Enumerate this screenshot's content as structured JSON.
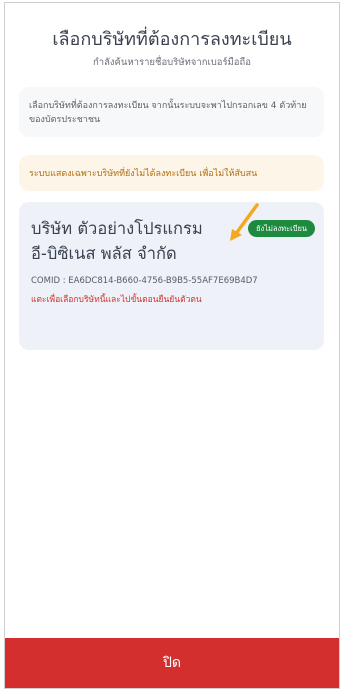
{
  "header": {
    "title": "เลือกบริษัทที่ต้องการลงทะเบียน",
    "subtitle": "กำลังค้นหารายชื่อบริษัทจากเบอร์มือถือ"
  },
  "instruction": {
    "text": "เลือกบริษัทที่ต้องการลงทะเบียน จากนั้นระบบจะพาไปกรอกเลข 4 ตัวท้ายของบัตรประชาชน"
  },
  "warning": {
    "text": "ระบบแสดงเฉพาะบริษัทที่ยังไม่ได้ลงทะเบียน เพื่อไม่ให้สับสน"
  },
  "company": {
    "name_line1": "บริษัท ตัวอย่างโปรแกรม",
    "name_line2": "อี-บิซิเนส พลัส  จำกัด",
    "status_badge": "ยังไม่ลงทะเบียน",
    "comid": "COMID : EA6DC814-B660-4756-B9B5-55AF7E69B4D7",
    "tap_hint": "แตะเพื่อเลือกบริษัทนี้และไปขั้นตอนยืนยันตัวตน"
  },
  "footer": {
    "close_label": "ปิด"
  },
  "colors": {
    "accent_red": "#d32f2f",
    "badge_green": "#1d8a3f",
    "warning_bg": "#fdf6e8",
    "card_bg": "#eef2f8",
    "arrow": "#f2a91f"
  },
  "icons": {
    "annotation": "arrow-icon"
  }
}
